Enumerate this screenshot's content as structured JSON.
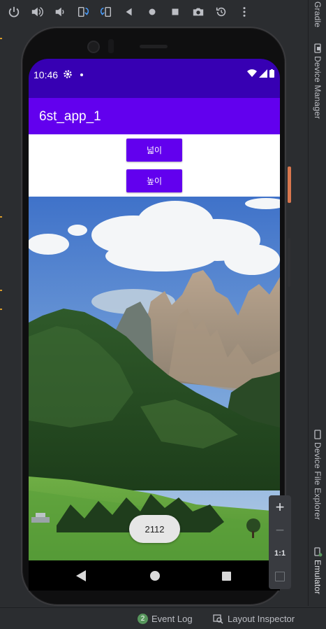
{
  "toolbar": {
    "icons": [
      "power-icon",
      "volume-up-icon",
      "volume-down-icon",
      "rotate-left-icon",
      "rotate-right-icon",
      "back-icon",
      "home-icon",
      "overview-icon",
      "camera-icon",
      "snapshot-icon",
      "more-icon"
    ]
  },
  "right_tabs": {
    "gradle": "Gradle",
    "device_manager": "Device Manager",
    "device_file_explorer": "Device File Explorer",
    "emulator": "Emulator"
  },
  "status": {
    "time": "10:46"
  },
  "app": {
    "title": "6st_app_1",
    "width_button": "넓이",
    "height_button": "높이",
    "toast": "2112"
  },
  "zoom": {
    "plus": "+",
    "minus": "−",
    "one_to_one": "1:1"
  },
  "bottom": {
    "event_log_count": "2",
    "event_log": "Event Log",
    "layout_inspector": "Layout Inspector"
  },
  "colors": {
    "status_bar": "#3700b3",
    "app_bar": "#6200ee",
    "button": "#6200ee",
    "ide_background": "#2b2d30"
  }
}
